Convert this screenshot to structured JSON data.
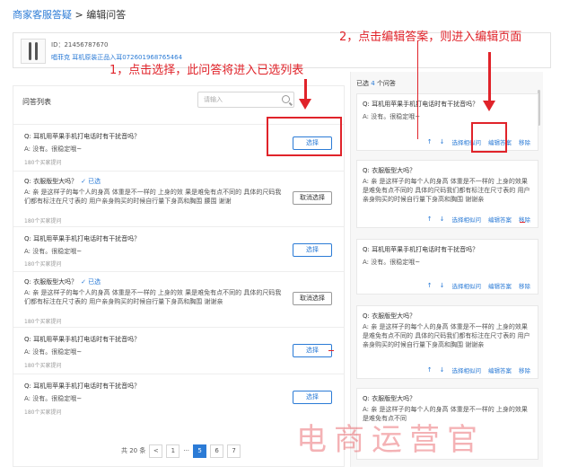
{
  "breadcrumb": {
    "link": "商家客服答疑",
    "sep": " > ",
    "current": "编辑问答"
  },
  "product": {
    "id_label": "ID：21456787670",
    "title": "唱菲克 耳机原装正品入耳072601968765464"
  },
  "annotations": {
    "step1": "1，点击选择，此问答将进入已选列表",
    "step2": "2，点击编辑答案，则进入编辑页面"
  },
  "left": {
    "header": "问答列表",
    "search_placeholder": "请输入",
    "items": [
      {
        "q": "Q:  耳机用苹果手机打电话时有干扰音吗？",
        "a": "A:  没有。很稳定哦~",
        "count": "180个买家提问",
        "selected_label": "",
        "button": "选择"
      },
      {
        "q": "Q:  衣服版型大吗？",
        "a": "A:  亲 是这样子的每个人的身高 体重是不一样的 上身的效     果是难免有点不同的 具体的尺码我们都有标注在尺寸表的 用户亲身购买的时候自行量下身高和胸围 腰围 谢谢",
        "count": "180个买家提问",
        "selected_label": "✓ 已选",
        "button": "取消选择"
      },
      {
        "q": "Q:  耳机用苹果手机打电话时有干扰音吗？",
        "a": "A:  没有。很稳定哦~",
        "count": "180个买家提问",
        "selected_label": "",
        "button": "选择"
      },
      {
        "q": "Q:  衣服版型大吗？",
        "a": "A:  亲 是这样子的每个人的身高 体重是不一样的 上身的效     果是难免有点不同的 具体的尺码我们都有标注在尺寸表的 用户亲身购买的时候自行量下身高和胸围 谢谢亲",
        "count": "180个买家提问",
        "selected_label": "✓ 已选",
        "button": "取消选择"
      },
      {
        "q": "Q:  耳机用苹果手机打电话时有干扰音吗？",
        "a": "A:  没有。很稳定哦~",
        "count": "180个买家提问",
        "selected_label": "",
        "button": "选择"
      },
      {
        "q": "Q:  耳机用苹果手机打电话时有干扰音吗？",
        "a": "A:  没有。很稳定哦~",
        "count": "180个买家提问",
        "selected_label": "",
        "button": "选择"
      }
    ],
    "pager": {
      "total": "共 20 条",
      "prev": "<",
      "pages": [
        "1",
        "···",
        "5",
        "6",
        "7"
      ],
      "active": "5"
    }
  },
  "right": {
    "header_pre": "已选",
    "header_count": "4",
    "header_post": "个问答",
    "items": [
      {
        "q": "Q:  耳机用苹果手机打电话时有干扰音吗？",
        "a": "A:  没有。很稳定哦~",
        "actions": [
          "选择相似问",
          "编辑答案",
          "移除"
        ]
      },
      {
        "q": "Q:  衣服版型大吗？",
        "a": "A:  亲 是这样子的每个人的身高 体重是不一样的 上身的效果是难免有点不同的 具体的尺码我们都有标注在尺寸表的 用户亲身购买的时候自行量下身高和胸围 谢谢亲",
        "actions": [
          "选择相似问",
          "编辑答案",
          "移除"
        ]
      },
      {
        "q": "Q:  耳机用苹果手机打电话时有干扰音吗？",
        "a": "A:  没有。很稳定哦~",
        "actions": [
          "选择相似问",
          "编辑答案",
          "移除"
        ]
      },
      {
        "q": "Q:  衣服版型大吗？",
        "a": "A:  亲 是这样子的每个人的身高 体重是不一样的 上身的效果是难免有点不同的 具体的尺码我们都有标注在尺寸表的 用户亲身购买的时候自行量下身高和胸围 谢谢亲",
        "actions": [
          "选择相似问",
          "编辑答案",
          "移除"
        ]
      },
      {
        "q": "Q:  衣服版型大吗？",
        "a": "A:  亲 是这样子的每个人的身高 体重是不一样的 上身的效果是难免有点不同",
        "actions": []
      }
    ]
  },
  "watermark": "电商运营官",
  "colors": {
    "accent": "#2b7bd6",
    "annotation": "#e0232a"
  }
}
